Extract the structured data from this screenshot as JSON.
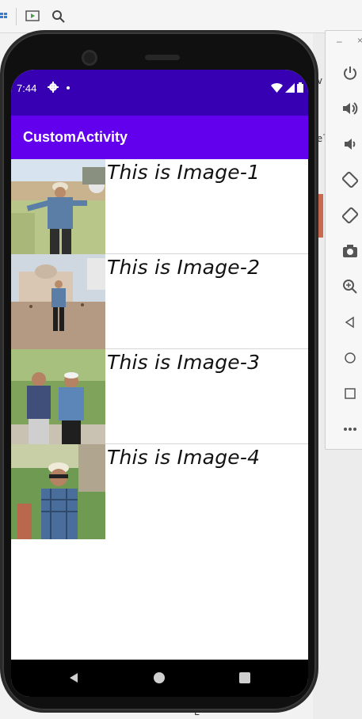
{
  "status_bar": {
    "time": "7:44"
  },
  "app_bar": {
    "title": "CustomActivity"
  },
  "list": {
    "items": [
      {
        "label": "This is Image-1"
      },
      {
        "label": "This is Image-2"
      },
      {
        "label": "This is Image-3"
      },
      {
        "label": "This is Image-4"
      }
    ]
  },
  "ide": {
    "fragments": [
      "v",
      "el",
      "E"
    ]
  },
  "colors": {
    "status_bar": "#3700b3",
    "app_bar": "#6200ee"
  },
  "emulator_toolbar": {
    "buttons": [
      "power-icon",
      "volume-up-icon",
      "volume-down-icon",
      "rotate-left-icon",
      "rotate-right-icon",
      "camera-icon",
      "zoom-icon",
      "back-icon",
      "home-icon",
      "overview-icon",
      "more-icon"
    ]
  }
}
